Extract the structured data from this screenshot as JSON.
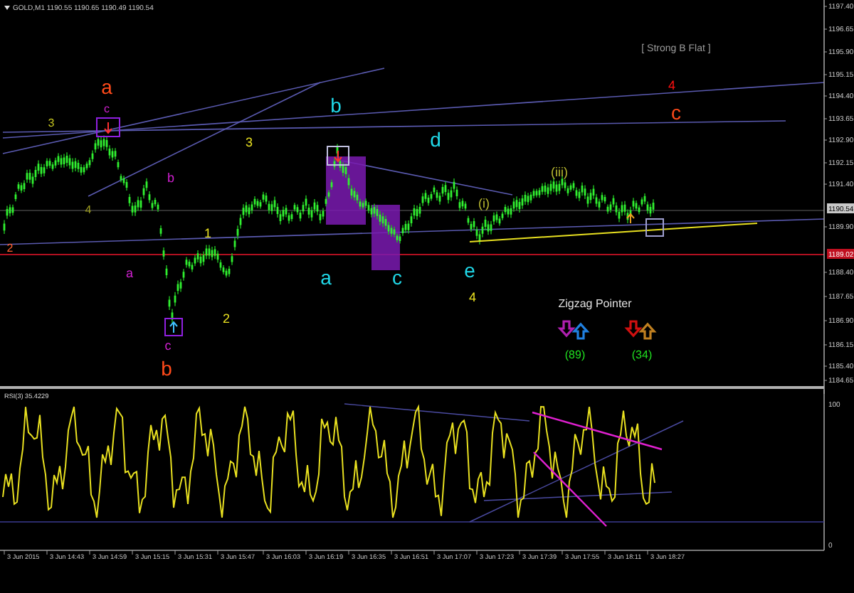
{
  "chart": {
    "title": "GOLD,M1  1190.55 1190.65 1190.49 1190.54",
    "note": "[ Strong B Flat ]",
    "price_ticks": [
      "1197.40",
      "1196.65",
      "1195.90",
      "1195.15",
      "1194.40",
      "1193.65",
      "1192.90",
      "1192.15",
      "1191.40",
      "1189.90",
      "1188.40",
      "1187.65",
      "1186.90",
      "1186.15",
      "1185.40",
      "1184.65"
    ],
    "current_price": "1190.54",
    "line_price": "1189.02",
    "wave_labels": [
      {
        "text": "a",
        "kind": "major",
        "color": "#ff4a1a"
      },
      {
        "text": "c",
        "kind": "tiny",
        "color": "#d020d0"
      },
      {
        "text": "3",
        "kind": "tiny",
        "color": "#c8c820"
      },
      {
        "text": "4",
        "kind": "tiny",
        "color": "#a0a020"
      },
      {
        "text": "2",
        "kind": "tiny",
        "color": "#ff6030"
      },
      {
        "text": "b",
        "kind": "minor",
        "color": "#d020d0"
      },
      {
        "text": "a",
        "kind": "minor",
        "color": "#d020d0"
      },
      {
        "text": "c",
        "kind": "minor",
        "color": "#d020d0"
      },
      {
        "text": "b",
        "kind": "major",
        "color": "#ff4a1a"
      },
      {
        "text": "3",
        "kind": "minor",
        "color": "#e8e020"
      },
      {
        "text": "1",
        "kind": "minor",
        "color": "#e8e020"
      },
      {
        "text": "2",
        "kind": "minor",
        "color": "#e8e020"
      },
      {
        "text": "b",
        "kind": "major",
        "color": "#20d8e8"
      },
      {
        "text": "d",
        "kind": "major",
        "color": "#20d8e8"
      },
      {
        "text": "a",
        "kind": "major",
        "color": "#20d8e8"
      },
      {
        "text": "c",
        "kind": "major",
        "color": "#20d8e8"
      },
      {
        "text": "e",
        "kind": "major",
        "color": "#20d8e8"
      },
      {
        "text": "4",
        "kind": "minor",
        "color": "#e8e020"
      },
      {
        "text": "(i)",
        "kind": "minor",
        "color": "#b8b830"
      },
      {
        "text": "(iii)",
        "kind": "minor",
        "color": "#b8b830"
      },
      {
        "text": "4",
        "kind": "minor",
        "color": "#ff1010"
      },
      {
        "text": "c",
        "kind": "major",
        "color": "#ff4a1a"
      }
    ],
    "zigzag_pointer": {
      "title": "Zigzag Pointer",
      "groups": [
        {
          "down": {
            "color": "#b020b0"
          },
          "up": {
            "color": "#2080e0"
          },
          "count": "(89)"
        },
        {
          "down": {
            "color": "#d01010"
          },
          "up": {
            "color": "#c08020"
          },
          "count": "(34)"
        }
      ]
    }
  },
  "rsi": {
    "label": "RSI(3) 35.4229",
    "axis": [
      "100",
      "0"
    ]
  },
  "time_axis": [
    "3 Jun 2015",
    "3 Jun 14:43",
    "3 Jun 14:59",
    "3 Jun 15:15",
    "3 Jun 15:31",
    "3 Jun 15:47",
    "3 Jun 16:03",
    "3 Jun 16:19",
    "3 Jun 16:35",
    "3 Jun 16:51",
    "3 Jun 17:07",
    "3 Jun 17:23",
    "3 Jun 17:39",
    "3 Jun 17:55",
    "3 Jun 18:11",
    "3 Jun 18:27"
  ]
}
